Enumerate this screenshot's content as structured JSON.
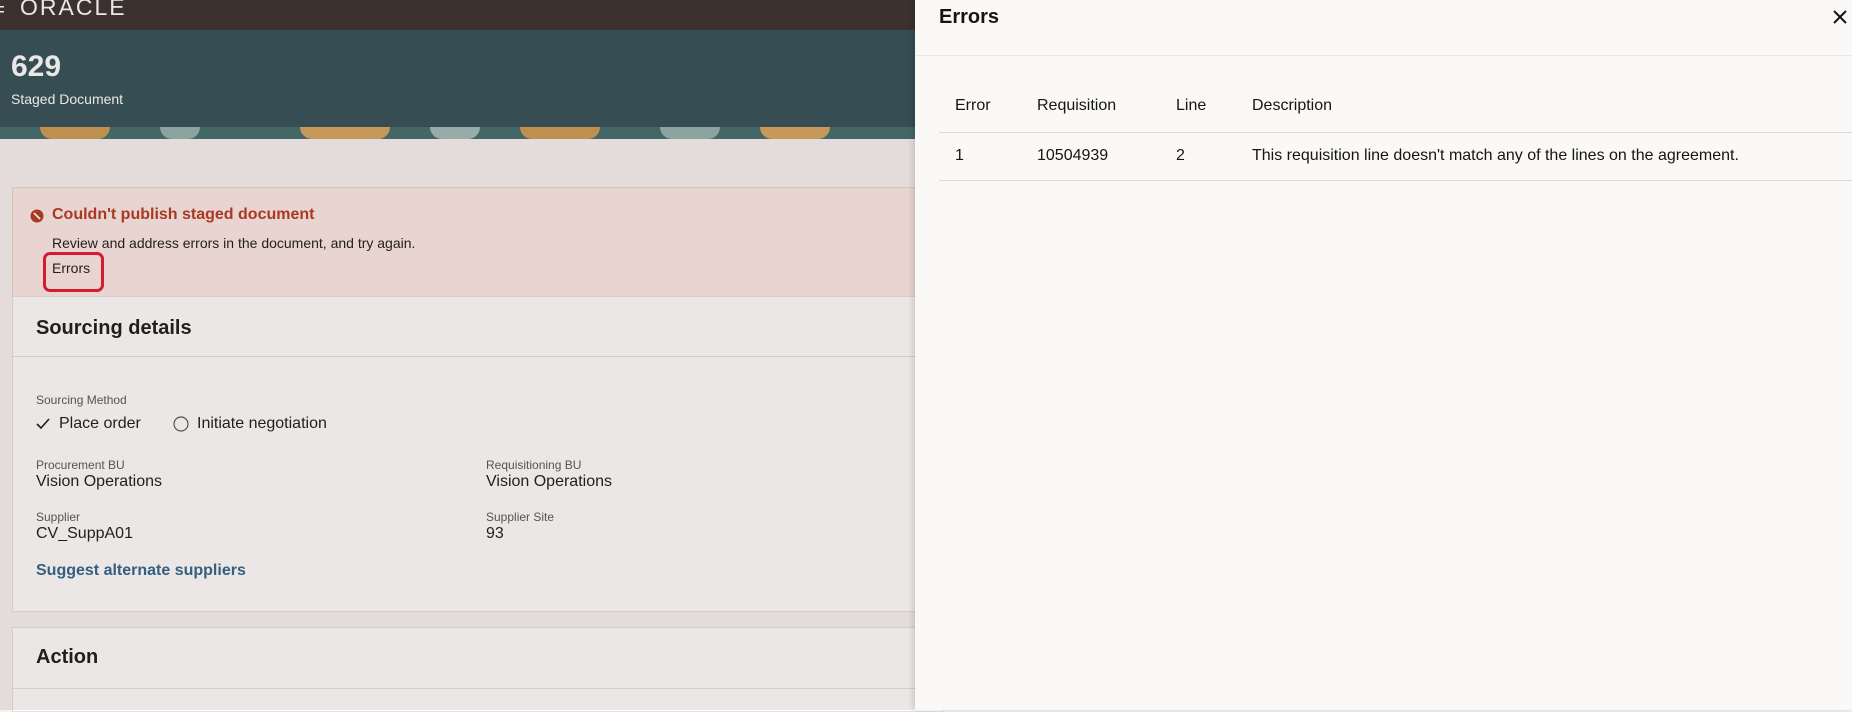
{
  "app": {
    "logo_text": "ORACLE"
  },
  "header": {
    "document_number": "629",
    "document_subtitle": "Staged Document"
  },
  "error_banner": {
    "title": "Couldn't publish staged document",
    "message": "Review and address errors in the document, and try again.",
    "errors_link": "Errors"
  },
  "sourcing": {
    "title": "Sourcing details",
    "method_label": "Sourcing Method",
    "option_place_order": "Place order",
    "option_initiate_negotiation": "Initiate negotiation",
    "selected_option": "Place order",
    "procurement_bu_label": "Procurement BU",
    "procurement_bu_value": "Vision Operations",
    "requisitioning_bu_label": "Requisitioning BU",
    "requisitioning_bu_value": "Vision Operations",
    "supplier_label": "Supplier",
    "supplier_value": "CV_SuppA01",
    "supplier_site_label": "Supplier Site",
    "supplier_site_value": "93",
    "suggest_link": "Suggest alternate suppliers"
  },
  "action": {
    "title": "Action"
  },
  "drawer": {
    "title": "Errors",
    "columns": [
      "Error",
      "Requisition",
      "Line",
      "Description"
    ],
    "rows": [
      {
        "error": "1",
        "requisition": "10504939",
        "line": "2",
        "description": "This requisition line doesn't match any of the lines on the agreement."
      }
    ]
  },
  "colors": {
    "header_bg": "#2a4c53",
    "topbar_bg": "#312d2a",
    "error_red": "#b3341b",
    "link_blue": "#2b6185",
    "highlight_red": "#e3122b"
  }
}
